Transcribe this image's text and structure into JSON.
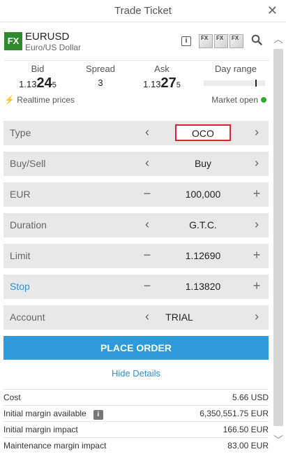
{
  "window": {
    "title": "Trade Ticket",
    "close_glyph": "✕"
  },
  "instrument": {
    "badge": "FX",
    "symbol": "EURUSD",
    "description": "Euro/US Dollar",
    "info_glyph": "i",
    "fx_buttons": [
      "FX",
      "FX",
      "FX"
    ]
  },
  "prices": {
    "bid": {
      "label": "Bid",
      "prefix": "1.13",
      "big": "24",
      "suffix": "5"
    },
    "spread": {
      "label": "Spread",
      "value": "3"
    },
    "ask": {
      "label": "Ask",
      "prefix": "1.13",
      "big": "27",
      "suffix": "5"
    },
    "day_range": {
      "label": "Day range"
    }
  },
  "status": {
    "bolt": "⚡",
    "realtime": "Realtime prices",
    "market": "Market open",
    "market_color": "#2eaa2e"
  },
  "form": {
    "rows": [
      {
        "label": "Type",
        "value": "OCO",
        "left": "‹",
        "right": "›"
      },
      {
        "label": "Buy/Sell",
        "value": "Buy",
        "left": "‹",
        "right": "›"
      },
      {
        "label": "EUR",
        "value": "100,000",
        "left": "−",
        "right": "+"
      },
      {
        "label": "Duration",
        "value": "G.T.C.",
        "left": "‹",
        "right": "›"
      },
      {
        "label": "Limit",
        "value": "1.12690",
        "left": "−",
        "right": "+"
      },
      {
        "label": "Stop",
        "value": "1.13820",
        "left": "−",
        "right": "+"
      },
      {
        "label": "Account",
        "value": "TRIAL",
        "left": "‹",
        "right": "›"
      }
    ]
  },
  "actions": {
    "place_order": "PLACE ORDER",
    "hide_details": "Hide Details"
  },
  "details": [
    {
      "key": "Cost",
      "value": "5.66 USD"
    },
    {
      "key": "Initial margin available",
      "value": "6,350,551.75 EUR",
      "info": "i"
    },
    {
      "key": "Initial margin impact",
      "value": "166.50 EUR"
    },
    {
      "key": "Maintenance margin impact",
      "value": "83.00 EUR"
    }
  ],
  "scrollbar": {
    "up": "︿",
    "down": "﹀"
  },
  "colors": {
    "accent": "#2e9ad9",
    "highlight_border": "#d9262c",
    "fx_green": "#2d8a2d"
  }
}
